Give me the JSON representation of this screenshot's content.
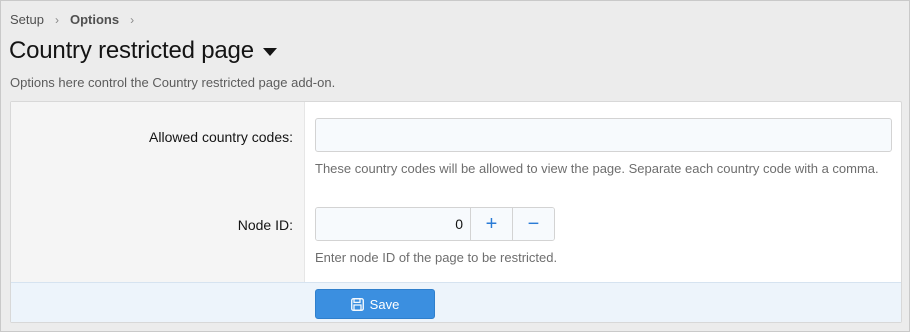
{
  "breadcrumb": {
    "items": [
      "Setup",
      "Options"
    ],
    "separator": "›"
  },
  "header": {
    "title": "Country restricted page",
    "description": "Options here control the Country restricted page add-on."
  },
  "form": {
    "country_codes": {
      "label": "Allowed country codes:",
      "value": "",
      "placeholder": "",
      "hint": "These country codes will be allowed to view the page. Separate each country code with a comma."
    },
    "node_id": {
      "label": "Node ID:",
      "value": "0",
      "increment_symbol": "+",
      "decrement_symbol": "−",
      "hint": "Enter node ID of the page to be restricted."
    }
  },
  "footer": {
    "save_label": "Save",
    "save_icon": "save-icon"
  },
  "colors": {
    "accent": "#3b8fe0",
    "stepper_symbol": "#2a7bd6",
    "footer_bg": "#edf4fb"
  }
}
